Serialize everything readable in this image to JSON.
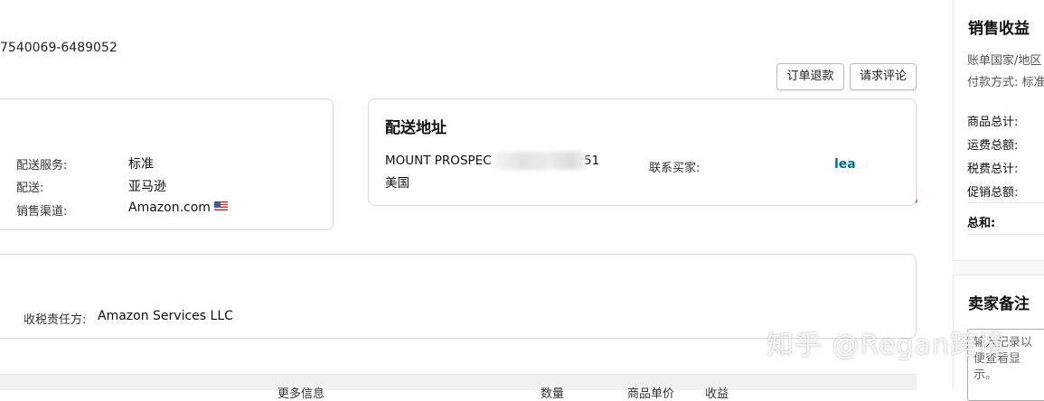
{
  "order": {
    "id_fragment": "7540069-6489052"
  },
  "actions": {
    "refund_label": "订单退款",
    "review_label": "请求评论"
  },
  "shipping_info": {
    "rows": [
      {
        "label": "配送服务:",
        "value": "标准"
      },
      {
        "label": "配送:",
        "value": "亚马逊"
      },
      {
        "label": "销售渠道:",
        "value": "Amazon.com"
      }
    ]
  },
  "address": {
    "title": "配送地址",
    "line1_visible_start": "MOUNT PROSPEC",
    "line1_visible_end": "51",
    "line2": "美国",
    "contact_label": "联系买家:",
    "contact_value": "lea"
  },
  "tax": {
    "label": "收税责任方:",
    "value": "Amazon Services LLC"
  },
  "table": {
    "headers": [
      "更多信息",
      "数量",
      "商品单价",
      "收益"
    ]
  },
  "sales_panel": {
    "title": "销售收益",
    "billing_country": "账单国家/地区",
    "payment_method": "付款方式: 标准",
    "rows": [
      "商品总计:",
      "运费总额:",
      "税费总计:",
      "促销总额:"
    ],
    "total_label": "总和:"
  },
  "notes_panel": {
    "title": "卖家备注",
    "placeholder": "输入记录以便查看显示。"
  },
  "watermark": "知乎 @Regan跨境",
  "colors": {
    "link": "#007185",
    "arrow": "#e02020",
    "border": "#d5d9d9"
  }
}
